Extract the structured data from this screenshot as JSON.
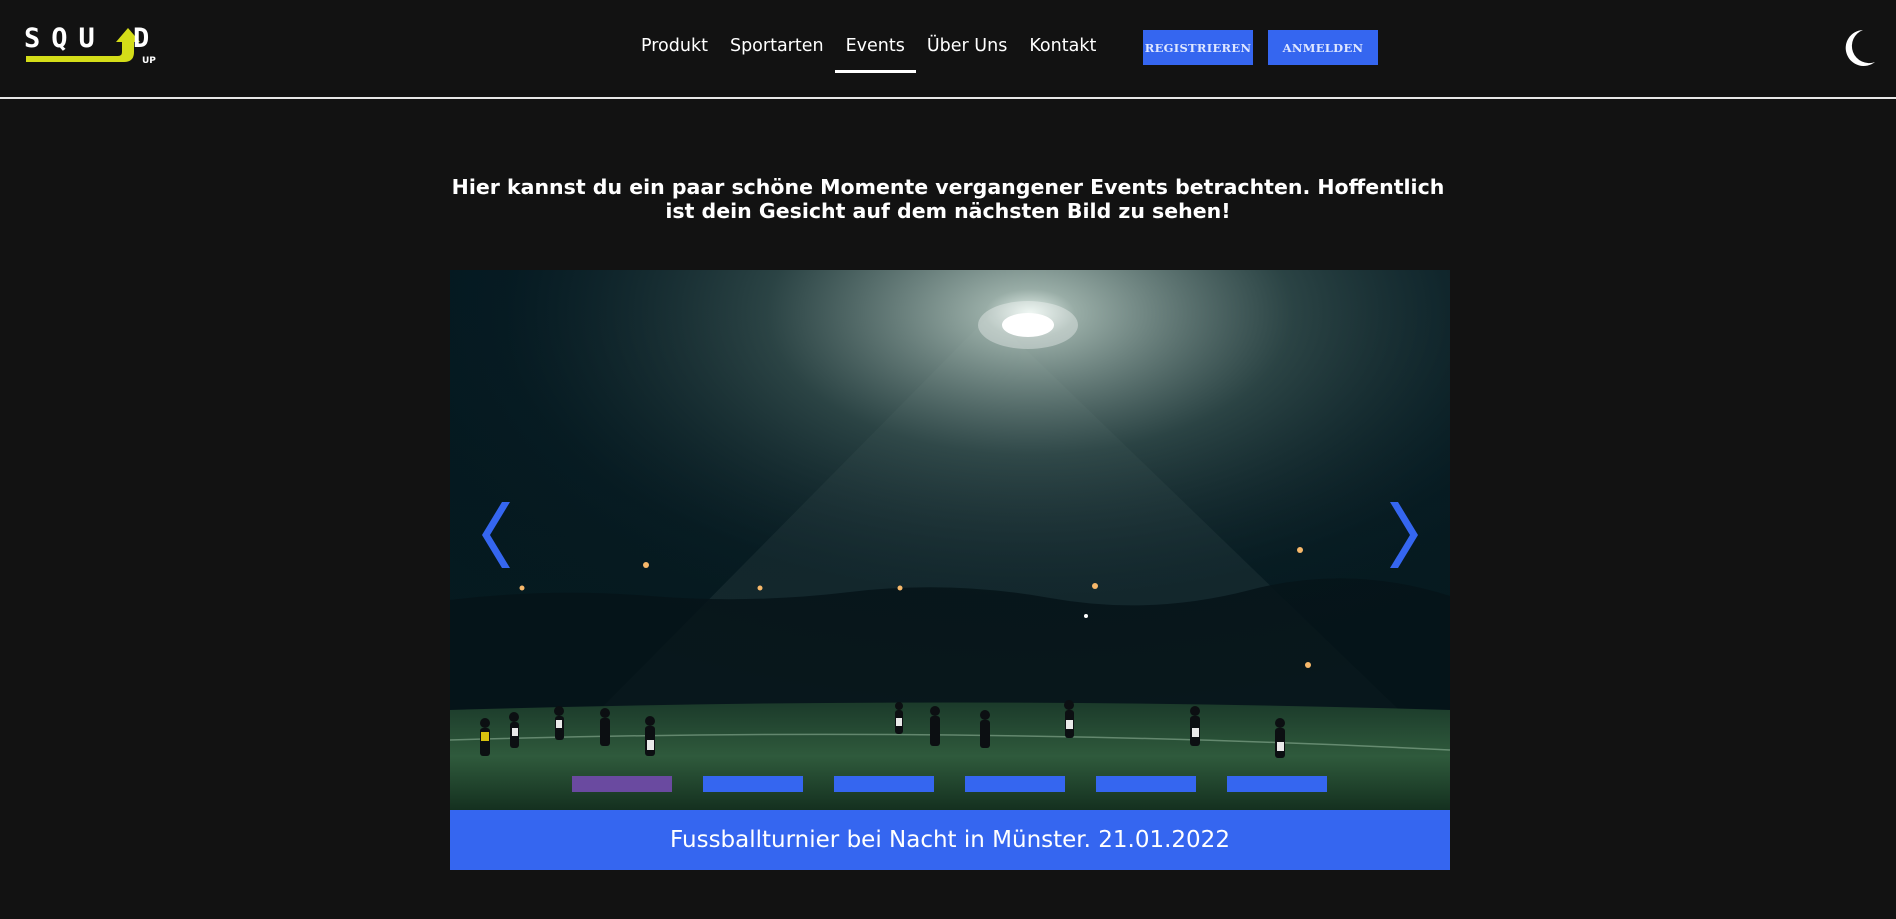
{
  "logo": {
    "word": "SQU D",
    "sub": "UP",
    "accent": "#d4dd18"
  },
  "nav": {
    "items": [
      {
        "label": "Produkt",
        "active": false
      },
      {
        "label": "Sportarten",
        "active": false
      },
      {
        "label": "Events",
        "active": true
      },
      {
        "label": "Über Uns",
        "active": false
      },
      {
        "label": "Kontakt",
        "active": false
      }
    ]
  },
  "auth": {
    "register_label": "REGISTRIEREN",
    "login_label": "ANMELDEN"
  },
  "theme_toggle": {
    "icon": "moon-icon"
  },
  "intro": {
    "line1": "Hier kannst du ein paar schöne Momente vergangener Events betrachten. Hoffentlich",
    "line2": "ist dein Gesicht auf dem nächsten Bild zu sehen!"
  },
  "slider": {
    "prev_icon": "chevron-left-icon",
    "next_icon": "chevron-right-icon",
    "slide_count": 6,
    "active_slide": 1,
    "caption": "Fussballturnier bei Nacht in Münster. 21.01.2022"
  },
  "colors": {
    "background": "#121212",
    "accent_blue": "#3566f0",
    "active_dot": "#6a4aa0"
  }
}
